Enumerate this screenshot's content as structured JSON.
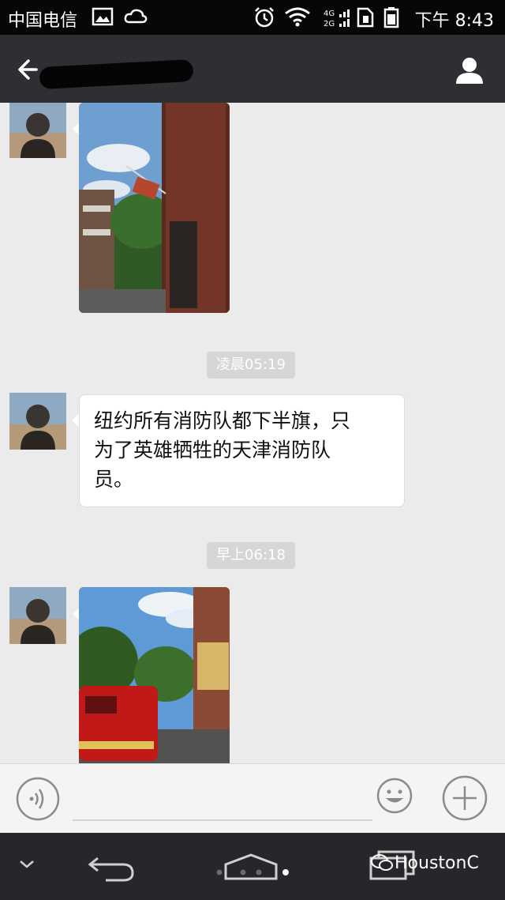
{
  "status_bar": {
    "carrier": "中国电信",
    "network_badge_top": "4G",
    "network_badge_bottom": "2G",
    "time": "下午 8:43",
    "icons": [
      "image-icon",
      "cloud-icon",
      "alarm-icon",
      "wifi-icon",
      "signal-icon",
      "sim-icon",
      "battery-icon"
    ]
  },
  "title_bar": {
    "contact_name": "",
    "back_icon": "back-arrow-icon",
    "profile_icon": "person-icon"
  },
  "messages": [
    {
      "type": "image",
      "sender": "contact",
      "description_icon": "photo-message"
    },
    {
      "type": "timestamp",
      "text": "凌晨05:19"
    },
    {
      "type": "text",
      "sender": "contact",
      "text_lines": [
        "纽约所有消防队都下半旗，只",
        "为了英雄牺牲的天津消防队",
        "员。"
      ]
    },
    {
      "type": "timestamp",
      "text": "早上06:18"
    },
    {
      "type": "image",
      "sender": "contact",
      "description_icon": "photo-message"
    }
  ],
  "input_bar": {
    "voice_icon": "voice-icon",
    "input_value": "",
    "emoji_icon": "emoji-icon",
    "plus_icon": "plus-icon"
  },
  "nav_bar": {
    "icons": [
      "chevron-down-icon",
      "back-icon",
      "home-icon",
      "recents-icon"
    ],
    "watermark": "HoustonC"
  },
  "colors": {
    "chat_bg": "#ecebec",
    "title_bg": "#2d2f33",
    "status_bg": "#070707",
    "nav_bg": "#26272a"
  }
}
